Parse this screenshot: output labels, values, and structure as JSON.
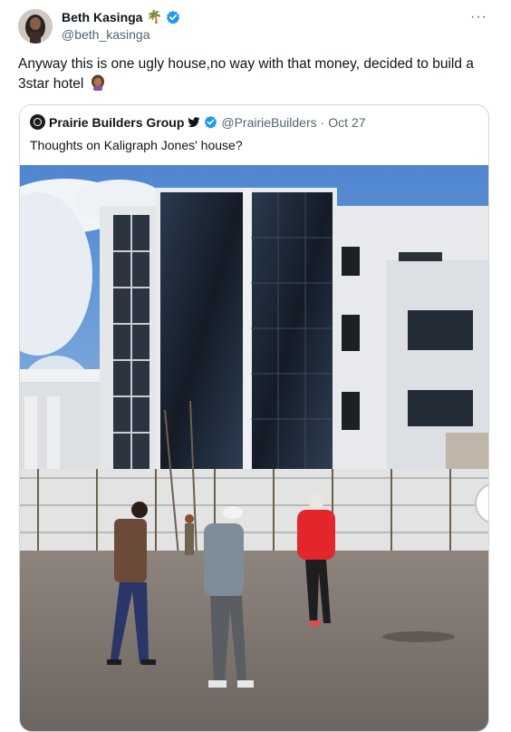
{
  "author": {
    "name": "Beth Kasinga",
    "name_emoji": "🌴",
    "handle": "@beth_kasinga"
  },
  "more_label": "···",
  "tweet": {
    "text": "Anyway this is one ugly house,no way with that money, decided to build a 3star hotel"
  },
  "quoted": {
    "name": "Prairie Builders Group",
    "handle": "@PrairieBuilders",
    "separator": "·",
    "date": "Oct 27",
    "text": "Thoughts on Kaligraph Jones' house?"
  },
  "colors": {
    "verified_blue": "#1d9bf0",
    "secondary_text": "#536471",
    "border": "#cfd9de",
    "sky": "#5b8fd0",
    "building_white": "#e6e8eb",
    "glass": "#1f2a38",
    "ground": "#7b7570"
  },
  "icons": [
    "palm-tree-emoji",
    "verified-badge-icon",
    "more-icon",
    "woman-facepalm-emoji",
    "twitter-bird-icon"
  ]
}
